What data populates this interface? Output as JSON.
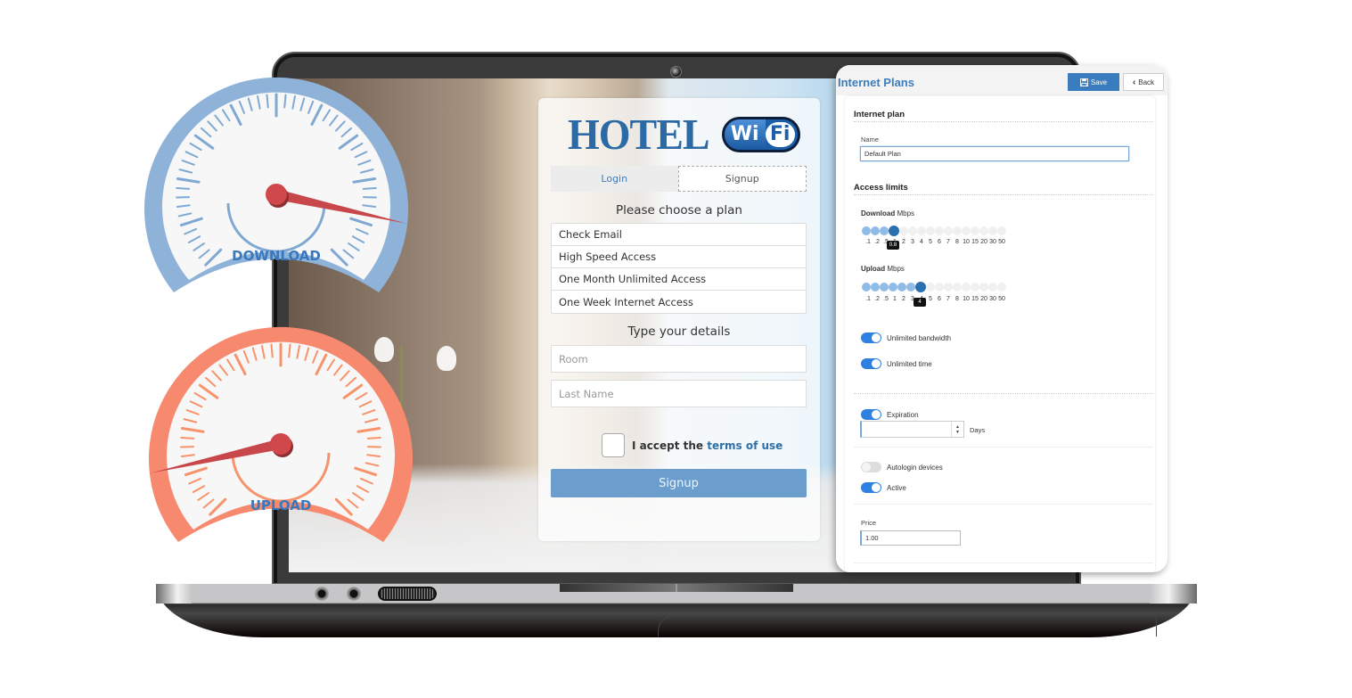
{
  "gauges": {
    "download": {
      "label": "DOWNLOAD",
      "ring_color": "#8fb3d8",
      "tick_color": "#7fa9d3",
      "needle_level_fraction": 0.88
    },
    "upload": {
      "label": "UPLOAD",
      "ring_color": "#f7896f",
      "tick_color": "#f7936b",
      "needle_level_fraction": 0.12
    }
  },
  "login_card": {
    "logo": {
      "hotel": "HOTEL",
      "wi": "Wi",
      "fi": "Fi"
    },
    "tabs": [
      {
        "label": "Login",
        "active": false
      },
      {
        "label": "Signup",
        "active": true
      }
    ],
    "choose_plan_title": "Please choose a plan",
    "plans": [
      "Check Email",
      "High Speed Access",
      "One Month Unlimited Access",
      "One Week Internet Access"
    ],
    "details_title": "Type your details",
    "fields": {
      "room": {
        "placeholder": "Room",
        "value": ""
      },
      "last_name": {
        "placeholder": "Last Name",
        "value": ""
      }
    },
    "terms": {
      "prefix": "I accept the",
      "link": "terms of use",
      "checked": false
    },
    "signup_button": "Signup"
  },
  "admin_panel": {
    "title": "Internet Plans",
    "save_button": "Save",
    "back_button": "Back",
    "section_plan": "Internet plan",
    "name_label": "Name",
    "name_value": "Default Plan",
    "section_limits": "Access limits",
    "download": {
      "label_bold": "Download",
      "label_unit": "Mbps",
      "ticks": [
        ".1",
        ".2",
        ".5",
        "1",
        "2",
        "3",
        "4",
        "5",
        "6",
        "7",
        "8",
        "10",
        "15",
        "20",
        "30",
        "50"
      ],
      "selected_value": "0.8",
      "selected_index": 3
    },
    "upload": {
      "label_bold": "Upload",
      "label_unit": "Mbps",
      "ticks": [
        ".1",
        ".2",
        ".5",
        "1",
        "2",
        "3",
        "4",
        "5",
        "6",
        "7",
        "8",
        "10",
        "15",
        "20",
        "30",
        "50"
      ],
      "selected_value": "4",
      "selected_index": 6
    },
    "toggles": {
      "unlimited_bandwidth": {
        "label": "Unlimited bandwidth",
        "on": true
      },
      "unlimited_time": {
        "label": "Unlimited time",
        "on": true
      },
      "expiration": {
        "label": "Expiration",
        "on": true
      },
      "autologin_devices": {
        "label": "Autologin devices",
        "on": false
      },
      "active": {
        "label": "Active",
        "on": true
      }
    },
    "expiration_days_value": "",
    "days_label": "Days",
    "price_label": "Price",
    "price_value": "1.00"
  }
}
